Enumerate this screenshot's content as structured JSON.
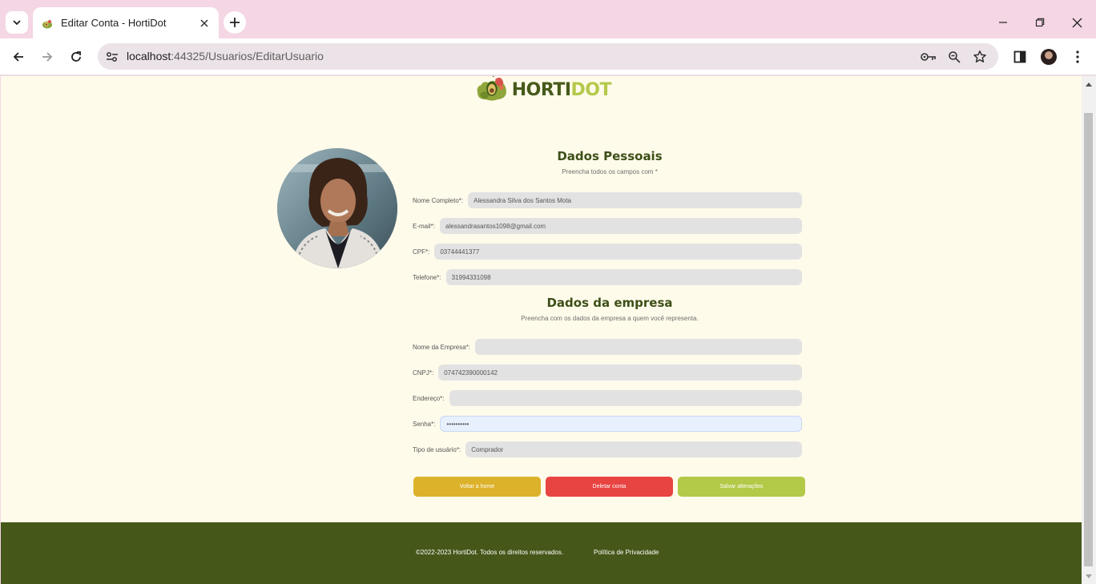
{
  "browser": {
    "tab_title": "Editar Conta - HortiDot",
    "url_host": "localhost",
    "url_path": ":44325/Usuarios/EditarUsuario"
  },
  "logo": {
    "part1": "HORTI",
    "part2": "DOT"
  },
  "personal": {
    "title": "Dados Pessoais",
    "subtitle": "Preencha todos os campos com *",
    "fields": [
      {
        "label": "Nome Completo*:",
        "value": "Alessandra Silva dos Santos Mota"
      },
      {
        "label": "E-mail*:",
        "value": "alessandrasantos1098@gmail.com"
      },
      {
        "label": "CPF*:",
        "value": "03744441377"
      },
      {
        "label": "Telefone*:",
        "value": "31994331098"
      }
    ]
  },
  "company": {
    "title": "Dados da empresa",
    "subtitle": "Preencha com os dados da empresa a quem você representa.",
    "fields": [
      {
        "label": "Nome da Empresa*:",
        "value": ""
      },
      {
        "label": "CNPJ*:",
        "value": "074742390000142"
      },
      {
        "label": "Endereço*:",
        "value": ""
      },
      {
        "label": "Senha*:",
        "value": "••••••••••"
      },
      {
        "label": "Tipo de usuário*:",
        "value": "Comprador"
      }
    ]
  },
  "buttons": {
    "home": "Voltar a home",
    "delete": "Deletar conta",
    "save": "Salvar alterações"
  },
  "footer": {
    "copyright": "©2022-2023 HortiDot. Todos os direitos reservados.",
    "privacy": "Política de Privacidade"
  },
  "colors": {
    "page_bg": "#fffbeb",
    "brand_dark": "#455719",
    "brand_light": "#b4c94a",
    "btn_home": "#ddb22b",
    "btn_delete": "#e84442",
    "btn_save": "#b3c948"
  }
}
